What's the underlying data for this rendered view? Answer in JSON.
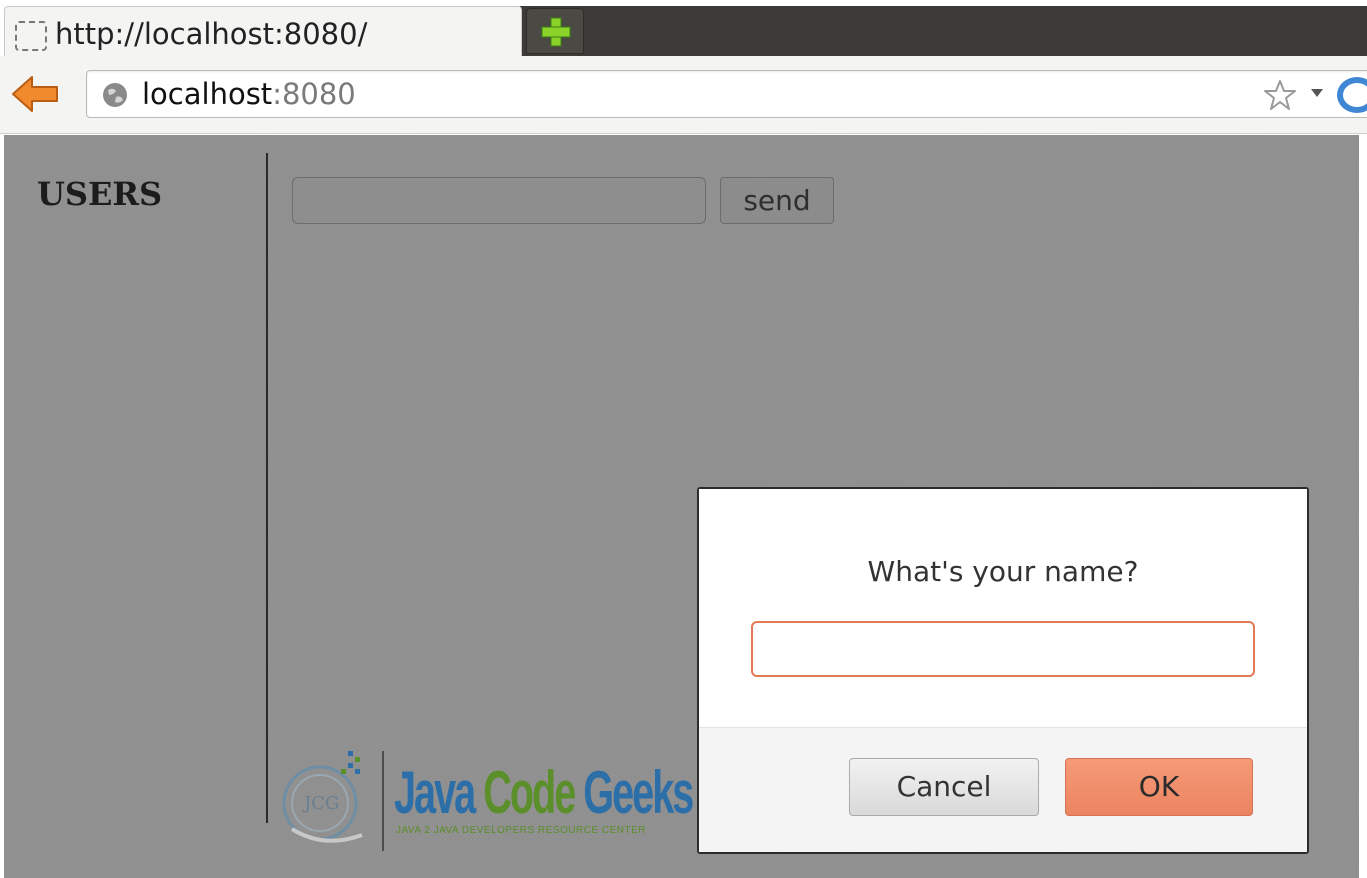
{
  "browser": {
    "tab": {
      "title": "http://localhost:8080/"
    },
    "address_bar": {
      "host": "localhost",
      "port": ":8080"
    }
  },
  "page": {
    "sidebar": {
      "title": "USERS"
    },
    "composer": {
      "message_value": "",
      "send_label": "send"
    }
  },
  "dialog": {
    "question": "What's your name?",
    "input_value": "",
    "cancel_label": "Cancel",
    "ok_label": "OK"
  },
  "watermark": {
    "word1": "Java",
    "word2": "Code",
    "word3": "Geeks",
    "tagline": "JAVA 2 JAVA DEVELOPERS RESOURCE CENTER"
  },
  "colors": {
    "accent": "#ec8460",
    "page_overlay": "#8f8f8f",
    "tab_strip": "#3c3b37"
  },
  "icons": [
    "page-icon",
    "new-tab-icon",
    "back-arrow-icon",
    "globe-icon",
    "bookmark-star-icon",
    "dropdown-caret-icon",
    "chrome-menu-icon"
  ]
}
